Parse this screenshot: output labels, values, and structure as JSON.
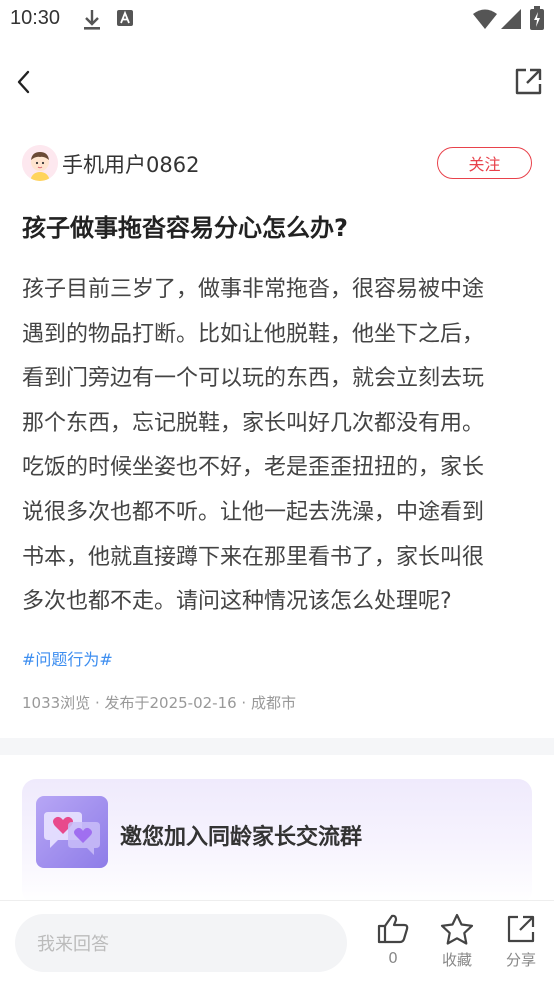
{
  "status_bar": {
    "time": "10:30"
  },
  "author": {
    "name": "手机用户0862",
    "follow_label": "关注"
  },
  "question": {
    "title": "孩子做事拖沓容易分心怎么办?",
    "body_lines": [
      "孩子目前三岁了，做事非常拖沓，很容易被中途",
      "遇到的物品打断。比如让他脱鞋，他坐下之后，",
      "看到门旁边有一个可以玩的东西，就会立刻去玩",
      "那个东西，忘记脱鞋，家长叫好几次都没有用。",
      "吃饭的时候坐姿也不好，老是歪歪扭扭的，家长",
      "说很多次也都不听。让他一起去洗澡，中途看到",
      "书本，他就直接蹲下来在那里看书了，家长叫很",
      "多次也都不走。请问这种情况该怎么处理呢?"
    ],
    "tag": "#问题行为#",
    "meta": "1033浏览 · 发布于2025-02-16 · 成都市"
  },
  "group_card": {
    "text": "邀您加入同龄家长交流群"
  },
  "bottom_bar": {
    "answer_placeholder": "我来回答",
    "like_count": "0",
    "collect_label": "收藏",
    "share_label": "分享"
  },
  "colors": {
    "accent_red": "#e8424b",
    "tag_blue": "#3d8ef0",
    "card_purple": "#9b88ee"
  },
  "icons": {
    "status": [
      "download-icon",
      "app-notification-icon",
      "wifi-icon",
      "signal-icon",
      "battery-icon"
    ],
    "nav": [
      "back-chevron-icon",
      "open-external-icon"
    ],
    "actions": [
      "thumbs-up-icon",
      "star-icon",
      "share-icon"
    ]
  }
}
